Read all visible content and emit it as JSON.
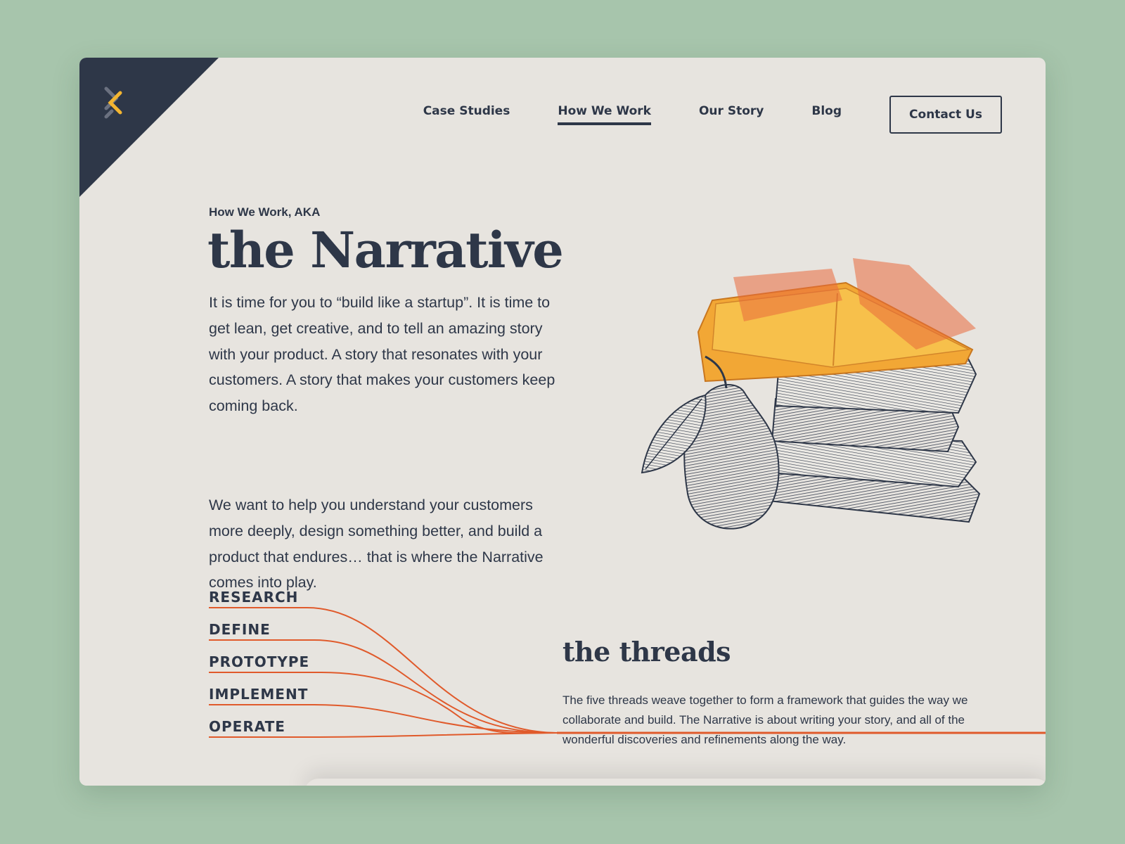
{
  "nav": {
    "items": [
      {
        "label": "Case Studies",
        "active": false
      },
      {
        "label": "How We Work",
        "active": true
      },
      {
        "label": "Our Story",
        "active": false
      },
      {
        "label": "Blog",
        "active": false
      }
    ],
    "cta_label": "Contact Us"
  },
  "hero": {
    "eyebrow": "How We Work, AKA",
    "title": "the Narrative",
    "paragraph_1": "It is time for you to “build like a startup”. It is time to get lean, get creative, and to tell an amazing story with your product. A story that resonates with your customers. A story that makes your customers keep coming back.",
    "paragraph_2": "We want to help you understand your customers more deeply, design something better, and build a product that endures… that is where the Narrative comes into play."
  },
  "threads": {
    "labels": [
      "RESEARCH",
      "DEFINE",
      "PROTOTYPE",
      "IMPLEMENT",
      "OPERATE"
    ],
    "title": "the threads",
    "description": "The five threads weave together to form a framework that guides the way we collaborate and build. The Narrative is about writing your story, and all of the wonderful discoveries and refinements along the way."
  },
  "colors": {
    "background": "#a7c5ac",
    "card": "#e7e4df",
    "navy": "#2e3748",
    "accent": "#e05a2b",
    "book_yellow": "#f2a735",
    "logo_yellow": "#f3b531"
  },
  "icons": {
    "logo": "interwoven-threads-logo",
    "illustration": "books-and-pear-engraving"
  }
}
